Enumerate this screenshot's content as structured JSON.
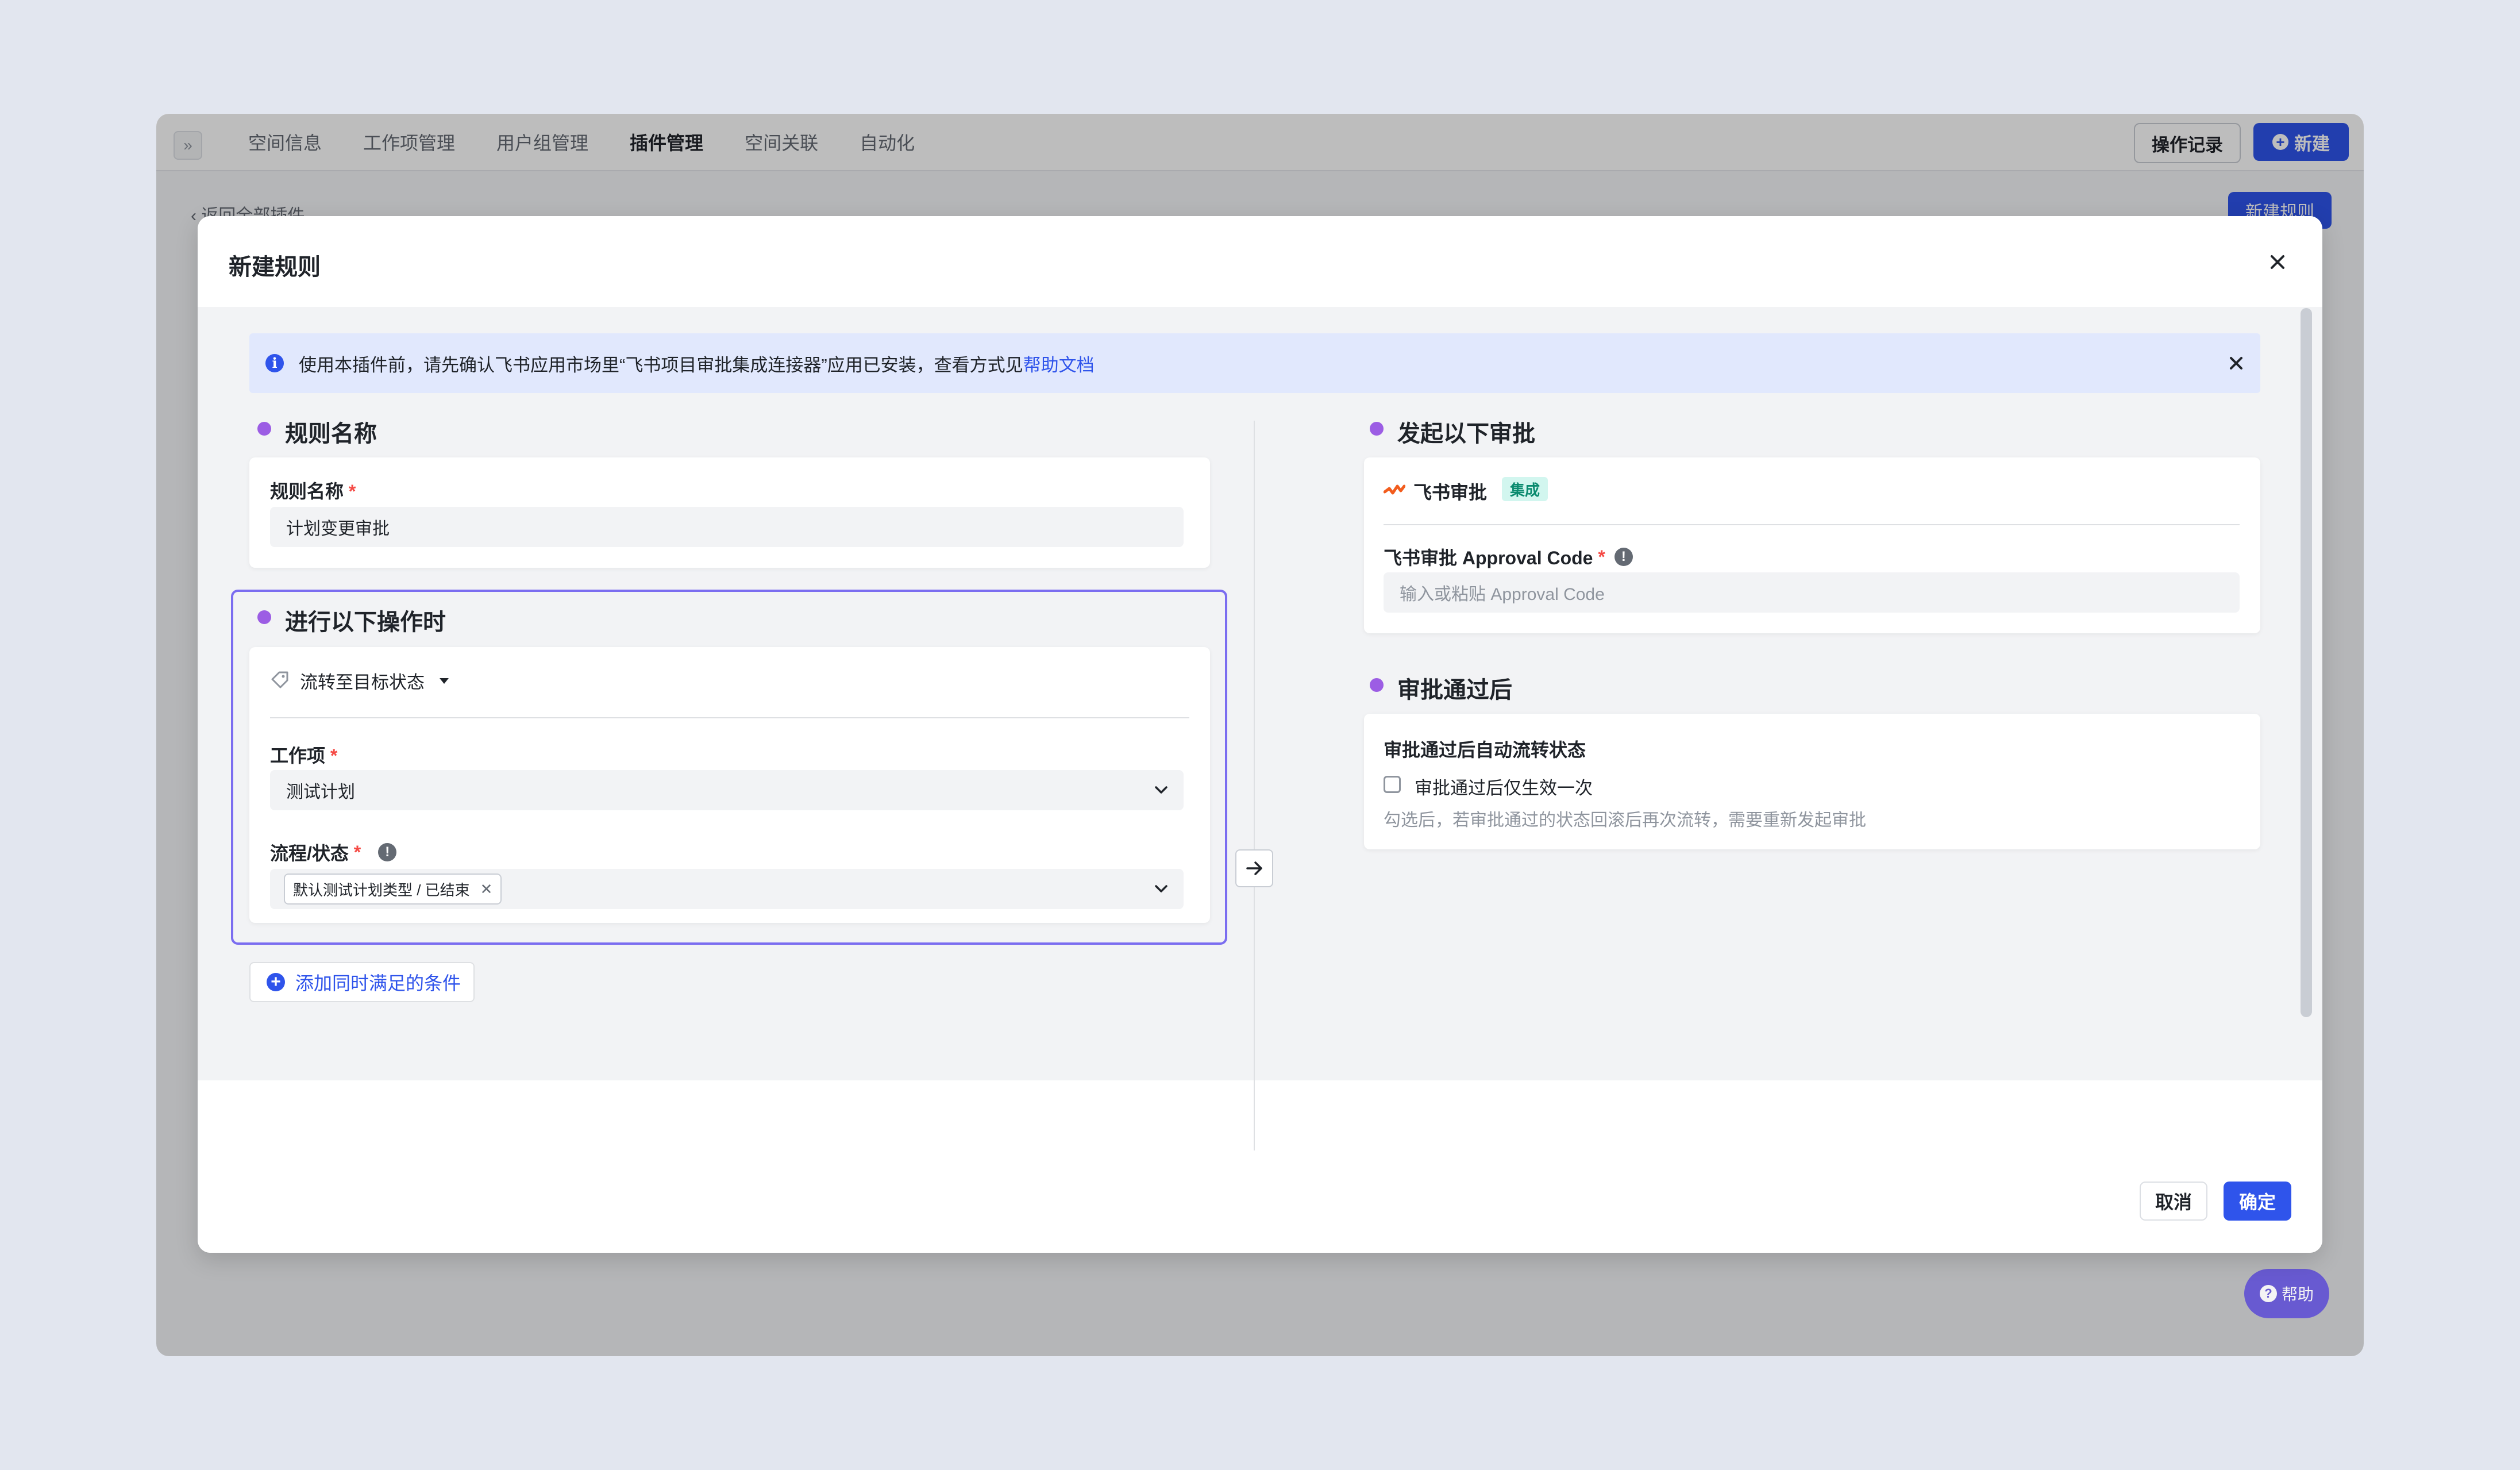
{
  "topbar": {
    "nav": [
      "空间信息",
      "工作项管理",
      "用户组管理",
      "插件管理",
      "空间关联",
      "自动化"
    ],
    "active_index": 3,
    "record_label": "操作记录",
    "new_label": "新建"
  },
  "background": {
    "back_link": "返回全部插件",
    "new_rule_label": "新建规则",
    "help_label": "帮助"
  },
  "modal": {
    "title": "新建规则",
    "banner": {
      "text": "使用本插件前，请先确认飞书应用市场里“飞书项目审批集成连接器”应用已安装，查看方式见",
      "link": "帮助文档"
    },
    "rule_name": {
      "section_title": "规则名称",
      "label": "规则名称",
      "required": "*",
      "value": "计划变更审批"
    },
    "trigger": {
      "section_title": "进行以下操作时",
      "action_label": "流转至目标状态",
      "work_item_label": "工作项",
      "required": "*",
      "work_item_value": "测试计划",
      "flow_label": "流程/状态",
      "flow_tag": "默认测试计划类型 / 已结束",
      "add_condition": "添加同时满足的条件"
    },
    "approval": {
      "section_title": "发起以下审批",
      "app_name": "飞书审批",
      "badge": "集成",
      "code_label": "飞书审批 Approval Code",
      "required": "*",
      "code_placeholder": "输入或粘贴 Approval Code"
    },
    "after": {
      "section_title": "审批通过后",
      "label": "审批通过后自动流转状态",
      "checkbox_label": "审批通过后仅生效一次",
      "hint": "勾选后，若审批通过的状态回滚后再次流转，需要重新发起审批"
    },
    "footer": {
      "cancel": "取消",
      "ok": "确定"
    }
  },
  "colors": {
    "primary": "#2f54eb",
    "accent_dot": "#9c5de4",
    "highlight_border": "#7b6df0",
    "banner_bg": "#e1e8fd",
    "badge_bg": "#d2f6ef",
    "required": "#f54a45"
  },
  "icons": [
    "expand-icon",
    "plus-circle-icon",
    "info-icon",
    "close-icon",
    "tag-icon",
    "caret-down-icon",
    "chevron-down-icon",
    "arrow-right-icon",
    "feishu-approval-logo",
    "warning-icon",
    "help-icon"
  ]
}
